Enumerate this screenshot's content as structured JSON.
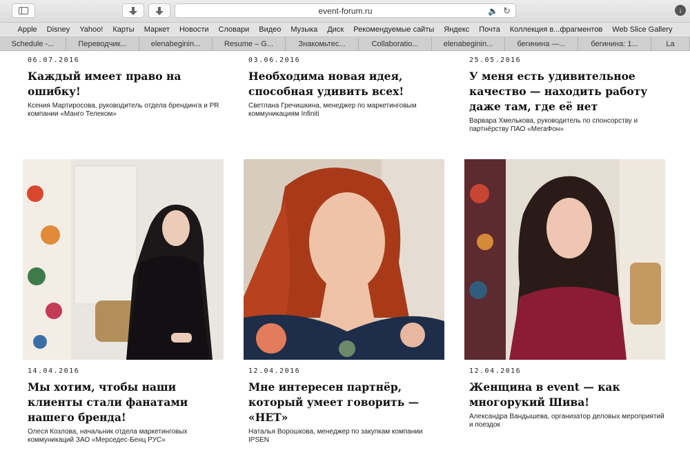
{
  "browser": {
    "url": "event-forum.ru",
    "bookmarks": [
      "Apple",
      "Disney",
      "Yahoo!",
      "Карты",
      "Маркет",
      "Новости",
      "Словари",
      "Видео",
      "Музыка",
      "Диск",
      "Рекомендуемые сайты",
      "Яндекс",
      "Почта",
      "Коллекция в...фрагментов",
      "Web Slice Gallery"
    ],
    "tabs": [
      "Schedule -...",
      "Переводчик...",
      "elenabeginin...",
      "Resume – G...",
      "Знакомьтес...",
      "Collaboratio...",
      "elenabeginin...",
      "бегинина —...",
      "бегинина: 1...",
      "La"
    ]
  },
  "articles": [
    {
      "date": "06.07.2016",
      "title": "Каждый имеет право на ошибку!",
      "author": "Ксения Мартиросова, руководитель отдела брендинга и PR компании «Манго Телеком»"
    },
    {
      "date": "03.06.2016",
      "title": "Необходима новая идея, способная удивить всех!",
      "author": "Светлана Гречишкина, менеджер по маркетинговым коммуникациям Infiniti"
    },
    {
      "date": "25.05.2016",
      "title": "У меня есть удивительное качество — находить работу даже там, где её нет",
      "author": "Варвара Хмелькова, руководитель по спонсорству и партнёрству ПАО «МегаФон»"
    },
    {
      "date": "14.04.2016",
      "title": "Мы хотим, чтобы наши клиенты стали фанатами нашего бренда!",
      "author": "Олеся Козлова, начальник отдела маркетинговых коммуникаций ЗАО «Мерседес-Бенц РУС»"
    },
    {
      "date": "12.04.2016",
      "title": "Мне интересен партнёр, который умеет говорить — «НЕТ»",
      "author": "Наталья Ворошкова, менеджер по закупкам компании IPSEN"
    },
    {
      "date": "12.04.2016",
      "title": "Женщина в event — как многорукий Шива!",
      "author": "Александра Вандышева, организатор деловых мероприятий и поездок"
    }
  ]
}
